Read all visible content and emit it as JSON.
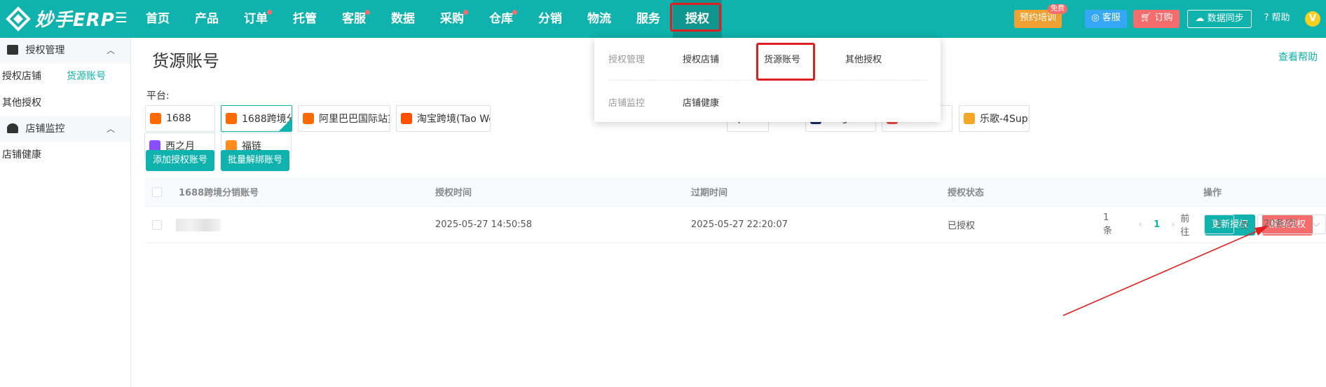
{
  "app": {
    "logo_text": "妙手ERP"
  },
  "nav": [
    {
      "label": "首页",
      "dot": false
    },
    {
      "label": "产品",
      "dot": false
    },
    {
      "label": "订单",
      "dot": true
    },
    {
      "label": "托管",
      "dot": false
    },
    {
      "label": "客服",
      "dot": true
    },
    {
      "label": "数据",
      "dot": false
    },
    {
      "label": "采购",
      "dot": true
    },
    {
      "label": "仓库",
      "dot": true
    },
    {
      "label": "分销",
      "dot": false
    },
    {
      "label": "物流",
      "dot": false
    },
    {
      "label": "服务",
      "dot": false
    },
    {
      "label": "授权",
      "dot": false,
      "active": true
    }
  ],
  "topbar": {
    "training_label": "预约培训",
    "training_badge": "免费",
    "service_label": "客服",
    "order_label": "订购",
    "sync_label": "数据同步",
    "help_label": "帮助",
    "avatar_letter": "V"
  },
  "sidebar": {
    "groups": [
      {
        "title": "授权管理",
        "items": [
          {
            "label": "授权店铺"
          },
          {
            "label": "货源账号",
            "active": true
          },
          {
            "label": "其他授权"
          }
        ]
      },
      {
        "title": "店铺监控",
        "items": [
          {
            "label": "店铺健康"
          }
        ]
      }
    ]
  },
  "page": {
    "title": "货源账号",
    "help_link": "查看帮助",
    "platform_label": "平台:",
    "platforms": [
      {
        "label": "1688",
        "icon": "alibaba-icon",
        "color": "#ff6a00"
      },
      {
        "label": "1688跨境分销",
        "icon": "alibaba-icon",
        "color": "#ff6a00",
        "selected": true
      },
      {
        "label": "阿里巴巴国际站货盘",
        "icon": "alibaba-icon",
        "color": "#ff6a00"
      },
      {
        "label": "淘宝跨境(Tao World)",
        "icon": "taobao-icon",
        "color": "#ff5000"
      },
      {
        "label": "op",
        "icon": "",
        "color": ""
      },
      {
        "label": "Kingnew",
        "icon": "kingnew-icon",
        "color": "#1a2a6c"
      },
      {
        "label": "YMS",
        "icon": "yms-icon",
        "color": "#e94b3c"
      },
      {
        "label": "乐歌-4Supply",
        "icon": "loctek-icon",
        "color": "#f5a623"
      },
      {
        "label": "西之月",
        "icon": "xizhiyue-icon",
        "color": "#8a4dff"
      },
      {
        "label": "福链",
        "icon": "fulian-icon",
        "color": "#ff8c1a"
      }
    ],
    "add_button": "添加授权账号",
    "unbind_button": "批量解绑账号"
  },
  "table": {
    "headers": {
      "account": "1688跨境分销账号",
      "auth_time": "授权时间",
      "expire_time": "过期时间",
      "status": "授权状态",
      "actions": "操作"
    },
    "rows": [
      {
        "auth_time": "2025-05-27 14:50:58",
        "expire_time": "2025-05-27 22:20:07",
        "status": "已授权",
        "renew": "更新授权",
        "revoke": "解除授权"
      }
    ]
  },
  "pager": {
    "total": "1条",
    "current": "1",
    "goto_label": "前往",
    "goto_value": "1",
    "page_suffix": "页",
    "page_size": "20条/页"
  },
  "dropdown": {
    "group1_label": "授权管理",
    "group1_links": [
      "授权店铺",
      "货源账号",
      "其他授权"
    ],
    "group2_label": "店铺监控",
    "group2_links": [
      "店铺健康"
    ]
  },
  "colors": {
    "brand": "#0fb2ac",
    "danger": "#f56c6c",
    "highlight": "#e02020"
  }
}
